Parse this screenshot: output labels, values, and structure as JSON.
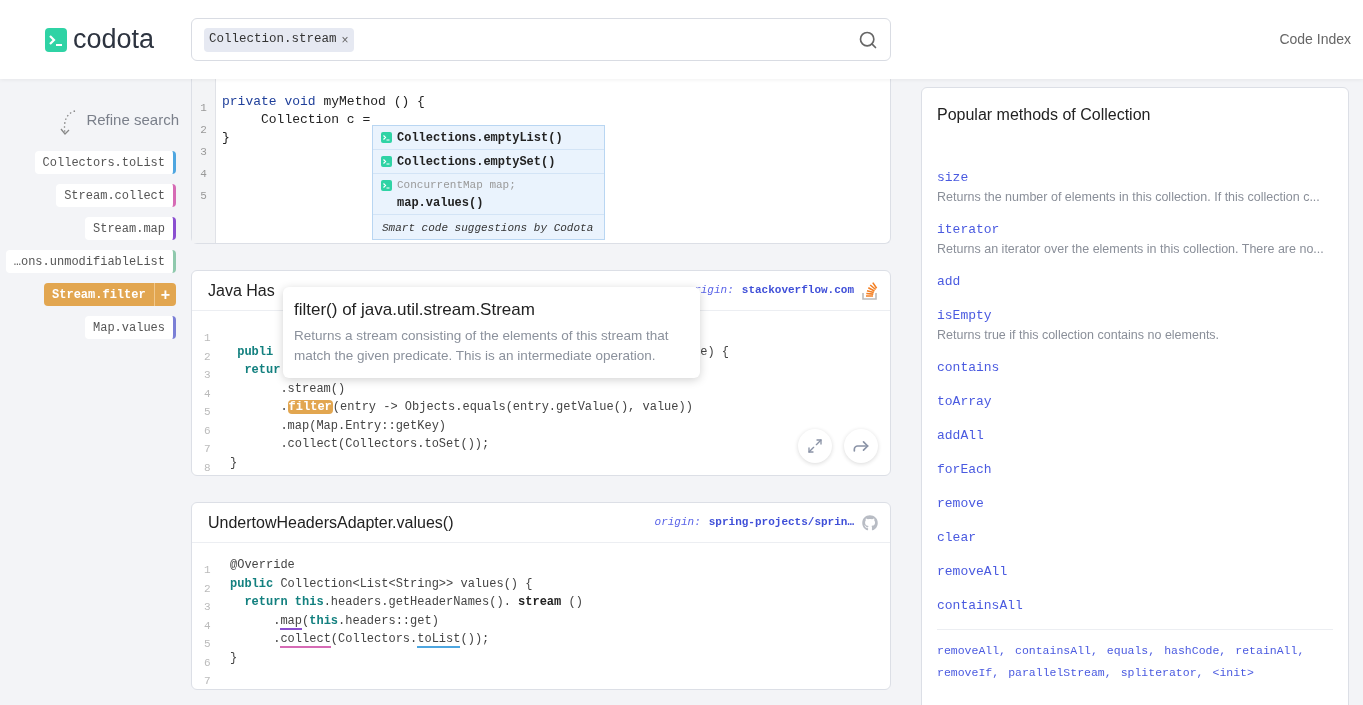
{
  "header": {
    "logo": "codota",
    "search": {
      "chips": [
        {
          "label": "Collection.stream",
          "remove": "×"
        }
      ]
    },
    "nav_link": "Code Index"
  },
  "sidebar": {
    "title": "Refine search",
    "items": [
      {
        "label": "Collectors.toList",
        "color": "#4ea6e0",
        "selected": false
      },
      {
        "label": "Stream.collect",
        "color": "#d66bb5",
        "selected": false
      },
      {
        "label": "Stream.map",
        "color": "#8b4fd0",
        "selected": false
      },
      {
        "label": "…ons.unmodifiableList",
        "color": "#8fc9ad",
        "selected": false
      },
      {
        "label": "Stream.filter",
        "color": "#e2a650",
        "selected": true,
        "add": "+"
      },
      {
        "label": "Map.values",
        "color": "#7b7fd6",
        "selected": false
      }
    ]
  },
  "editor": {
    "lines": [
      {
        "number": "1",
        "tokens": [
          {
            "text": "private void",
            "kind": "decl"
          },
          {
            "text": " myMethod () {",
            "kind": "plain"
          }
        ]
      },
      {
        "number": "2",
        "tokens": [
          {
            "text": "     Collection c =",
            "kind": "plain"
          }
        ]
      },
      {
        "number": "3",
        "tokens": [
          {
            "text": "}",
            "kind": "plain"
          }
        ]
      },
      {
        "number": "4"
      },
      {
        "number": "5"
      }
    ],
    "suggestions": {
      "items": [
        {
          "name": "Collections.emptyList()"
        },
        {
          "name": "Collections.emptySet()"
        },
        {
          "context": "ConcurrentMap map;",
          "name": "map.values()"
        }
      ],
      "footer": "Smart code suggestions by Codota"
    }
  },
  "results": [
    {
      "title": "Java Has",
      "origin": {
        "label": "rigin:",
        "text": "stackoverflow.com",
        "kind": "stackoverflow"
      },
      "lines": [
        {
          "number": "1"
        },
        {
          "number": "2",
          "tokens": [
            {
              "text": " publi",
              "kind": "keyword"
            },
            {
              "text": "e) {",
              "kind": "plain",
              "after_cover": true
            }
          ]
        },
        {
          "number": "3",
          "tokens": [
            {
              "text": "  retur",
              "kind": "keyword"
            }
          ]
        },
        {
          "number": "4",
          "tokens": [
            {
              "text": "       .stream()",
              "kind": "plain"
            }
          ]
        },
        {
          "number": "5",
          "tokens": [
            {
              "text": "       .",
              "kind": "plain"
            },
            {
              "text": "filter",
              "kind": "highlight"
            },
            {
              "text": "(entry -> Objects.equals(entry.getValue(), value))",
              "kind": "plain"
            }
          ]
        },
        {
          "number": "6",
          "tokens": [
            {
              "text": "       .map(Map.Entry::getKey)",
              "kind": "plain"
            }
          ]
        },
        {
          "number": "7",
          "tokens": [
            {
              "text": "       .collect(Collectors.toSet());",
              "kind": "plain"
            }
          ]
        },
        {
          "number": "8",
          "tokens": [
            {
              "text": "}",
              "kind": "plain"
            }
          ]
        }
      ],
      "tooltip": {
        "title": "filter() of java.util.stream.Stream",
        "description": "Returns a stream consisting of the elements of this stream that match the given predicate. This is an intermediate operation."
      },
      "actions": [
        {
          "kind": "expand"
        },
        {
          "kind": "share"
        }
      ]
    },
    {
      "title": "UndertowHeadersAdapter.values()",
      "origin": {
        "label": "origin:",
        "text": "spring-projects/sprin…",
        "kind": "github"
      },
      "lines": [
        {
          "number": "1",
          "tokens": [
            {
              "text": "@Override",
              "kind": "plain"
            }
          ]
        },
        {
          "number": "2",
          "tokens": [
            {
              "text": "public",
              "kind": "keyword"
            },
            {
              "text": " Collection<List<String>> values() {",
              "kind": "plain"
            }
          ]
        },
        {
          "number": "3",
          "tokens": [
            {
              "text": "  return this",
              "kind": "keyword"
            },
            {
              "text": ".headers.getHeaderNames(). ",
              "kind": "plain"
            },
            {
              "text": "stream",
              "kind": "bold"
            },
            {
              "text": " ()",
              "kind": "plain"
            }
          ]
        },
        {
          "number": "4",
          "tokens": [
            {
              "text": "      .",
              "kind": "plain"
            },
            {
              "text": "map",
              "kind": "underline",
              "color": "#8b4fd0"
            },
            {
              "text": "(",
              "kind": "plain"
            },
            {
              "text": "this",
              "kind": "keyword"
            },
            {
              "text": ".headers::get)",
              "kind": "plain"
            }
          ]
        },
        {
          "number": "5",
          "tokens": [
            {
              "text": "      .",
              "kind": "plain"
            },
            {
              "text": "collect",
              "kind": "underline",
              "color": "#d66bb5"
            },
            {
              "text": "(Collectors.",
              "kind": "plain"
            },
            {
              "text": "toList",
              "kind": "underline",
              "color": "#4ea6e0"
            },
            {
              "text": "());",
              "kind": "plain"
            }
          ]
        },
        {
          "number": "6",
          "tokens": [
            {
              "text": "}",
              "kind": "plain"
            }
          ]
        },
        {
          "number": "7"
        }
      ]
    }
  ],
  "popular": {
    "title": "Popular methods of Collection",
    "methods": [
      {
        "name": "size",
        "description": "Returns the number of elements in this collection. If this collection c..."
      },
      {
        "name": "iterator",
        "description": "Returns an iterator over the elements in this collection. There are no..."
      },
      {
        "name": "add"
      },
      {
        "name": "isEmpty",
        "description": "Returns true if this collection contains no elements."
      },
      {
        "name": "contains"
      },
      {
        "name": "toArray"
      },
      {
        "name": "addAll"
      },
      {
        "name": "forEach"
      },
      {
        "name": "remove"
      },
      {
        "name": "clear"
      },
      {
        "name": "removeAll"
      },
      {
        "name": "containsAll"
      }
    ],
    "more": [
      "removeAll,",
      "containsAll,",
      "equals,",
      "hashCode,",
      "retainAll,",
      "removeIf,",
      "parallelStream,",
      "spliterator,",
      "<init>"
    ]
  }
}
